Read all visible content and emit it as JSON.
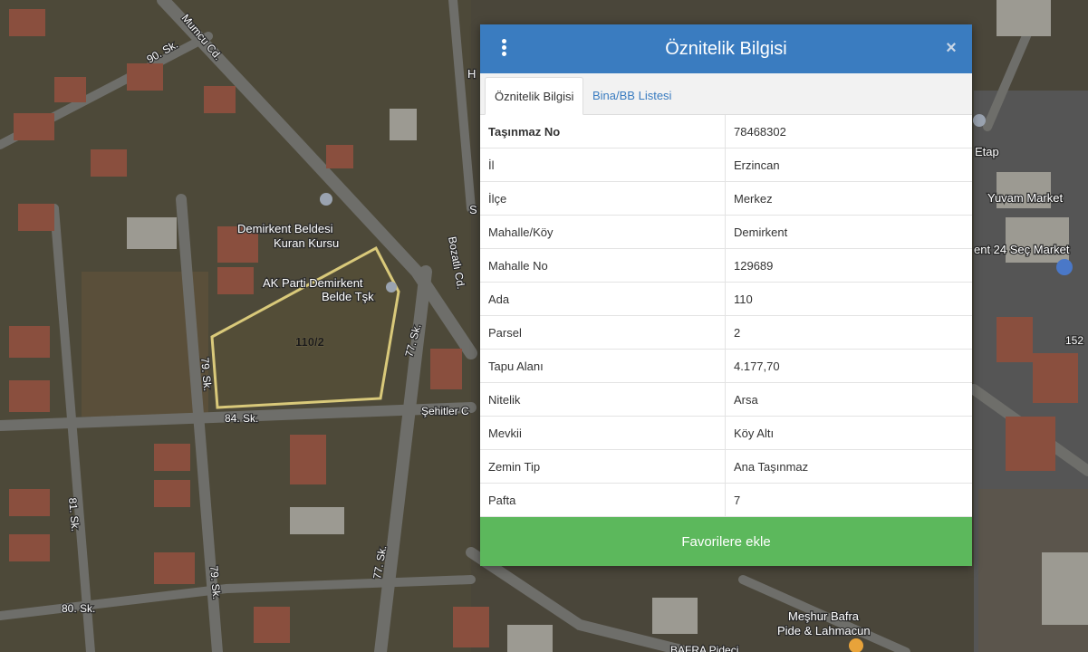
{
  "map": {
    "streets": [
      "90. Sk.",
      "Mumcu Cd.",
      "79. Sk.",
      "84. Sk.",
      "81. Sk.",
      "80. Sk.",
      "77. Sk.",
      "Bozatlı Cd.",
      "Şehitler C"
    ],
    "places": [
      "Demirkent Beldesi",
      "Kuran Kursu",
      "AK Parti Demirkent",
      "Belde Tşk",
      "Etap",
      "Yuvam Market",
      "ent 24 Seç Market",
      "Meşhur Bafra",
      "Pide & Lahmacun",
      "BAFRA Pideci"
    ],
    "parcel_label": "110/2",
    "edge_labels": [
      "H",
      "S",
      "152"
    ],
    "parcel_outline_color": "#d9c97a"
  },
  "panel": {
    "title": "Öznitelik Bilgisi",
    "close_symbol": "×",
    "header_color": "#3a7cc0",
    "tabs": [
      {
        "label": "Öznitelik Bilgisi",
        "active": true
      },
      {
        "label": "Bina/BB Listesi",
        "active": false
      }
    ],
    "rows": [
      {
        "key": "Taşınmaz No",
        "value": "78468302"
      },
      {
        "key": "İl",
        "value": "Erzincan"
      },
      {
        "key": "İlçe",
        "value": "Merkez"
      },
      {
        "key": "Mahalle/Köy",
        "value": "Demirkent"
      },
      {
        "key": "Mahalle No",
        "value": "129689"
      },
      {
        "key": "Ada",
        "value": "110"
      },
      {
        "key": "Parsel",
        "value": "2"
      },
      {
        "key": "Tapu Alanı",
        "value": "4.177,70"
      },
      {
        "key": "Nitelik",
        "value": "Arsa"
      },
      {
        "key": "Mevkii",
        "value": "Köy Altı"
      },
      {
        "key": "Zemin Tip",
        "value": "Ana Taşınmaz"
      },
      {
        "key": "Pafta",
        "value": "7"
      }
    ],
    "favorite_button": "Favorilere ekle",
    "favorite_color": "#5cb85c"
  }
}
